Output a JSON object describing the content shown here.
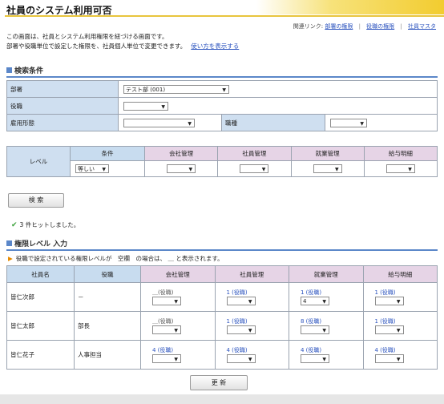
{
  "page": {
    "title": "社員のシステム利用可否"
  },
  "related": {
    "prefix": "関連リンク:",
    "links": [
      "部署の権限",
      "役職の権限",
      "社員マスタ"
    ],
    "separator": "|"
  },
  "intro": {
    "line1": "この画面は、社員とシステム利用権限を紐づける画面です。",
    "line2": "部署や役職単位で設定した権限を、社員個人単位で変更できます。",
    "help_link": "使い方を表示する"
  },
  "search": {
    "heading": "検索条件",
    "dept_label": "部署",
    "dept_value": "テスト部 (001)",
    "position_label": "役職",
    "position_value": "",
    "employment_label": "雇用形態",
    "employment_value": "",
    "jobtype_label": "職種",
    "jobtype_value": ""
  },
  "level_filter": {
    "row_label": "レベル",
    "cond_header": "条件",
    "cond_value": "等しい",
    "cols": [
      "会社管理",
      "社員管理",
      "就業管理",
      "給与明細"
    ]
  },
  "search_button": "検 索",
  "hit_message": "3 件ヒットしました。",
  "auth": {
    "heading": "権限レベル 入力",
    "note": "役職で設定されている権限レベルが　空欄　の場合は、 ＿ と表示されます。",
    "headers": [
      "社員名",
      "役職",
      "会社管理",
      "社員管理",
      "就業管理",
      "給与明細"
    ],
    "rows": [
      {
        "name": "皆仁次郎",
        "position": "－",
        "cells": [
          {
            "level": "＿(役職)",
            "sel": ""
          },
          {
            "level": "1 (役職)",
            "sel": ""
          },
          {
            "level": "1 (役職)",
            "sel": "4"
          },
          {
            "level": "1 (役職)",
            "sel": ""
          }
        ]
      },
      {
        "name": "皆仁太郎",
        "position": "部長",
        "cells": [
          {
            "level": "＿(役職)",
            "sel": ""
          },
          {
            "level": "1 (役職)",
            "sel": ""
          },
          {
            "level": "8 (役職)",
            "sel": ""
          },
          {
            "level": "1 (役職)",
            "sel": ""
          }
        ]
      },
      {
        "name": "皆仁花子",
        "position": "人事担当",
        "cells": [
          {
            "level": "4 (役職)",
            "sel": ""
          },
          {
            "level": "4 (役職)",
            "sel": ""
          },
          {
            "level": "4 (役職)",
            "sel": ""
          },
          {
            "level": "4 (役職)",
            "sel": ""
          }
        ]
      }
    ]
  },
  "update_button": "更 新",
  "colors": {
    "accent_blue": "#5b87c9",
    "title_yellow": "#f2cc2f",
    "label_bg": "#cfdff0",
    "pink_header": "#e6d4e6",
    "link": "#2a52be"
  },
  "icons": {
    "dropdown": "triangle-down",
    "check": "check-mark",
    "note": "triangle-right"
  }
}
